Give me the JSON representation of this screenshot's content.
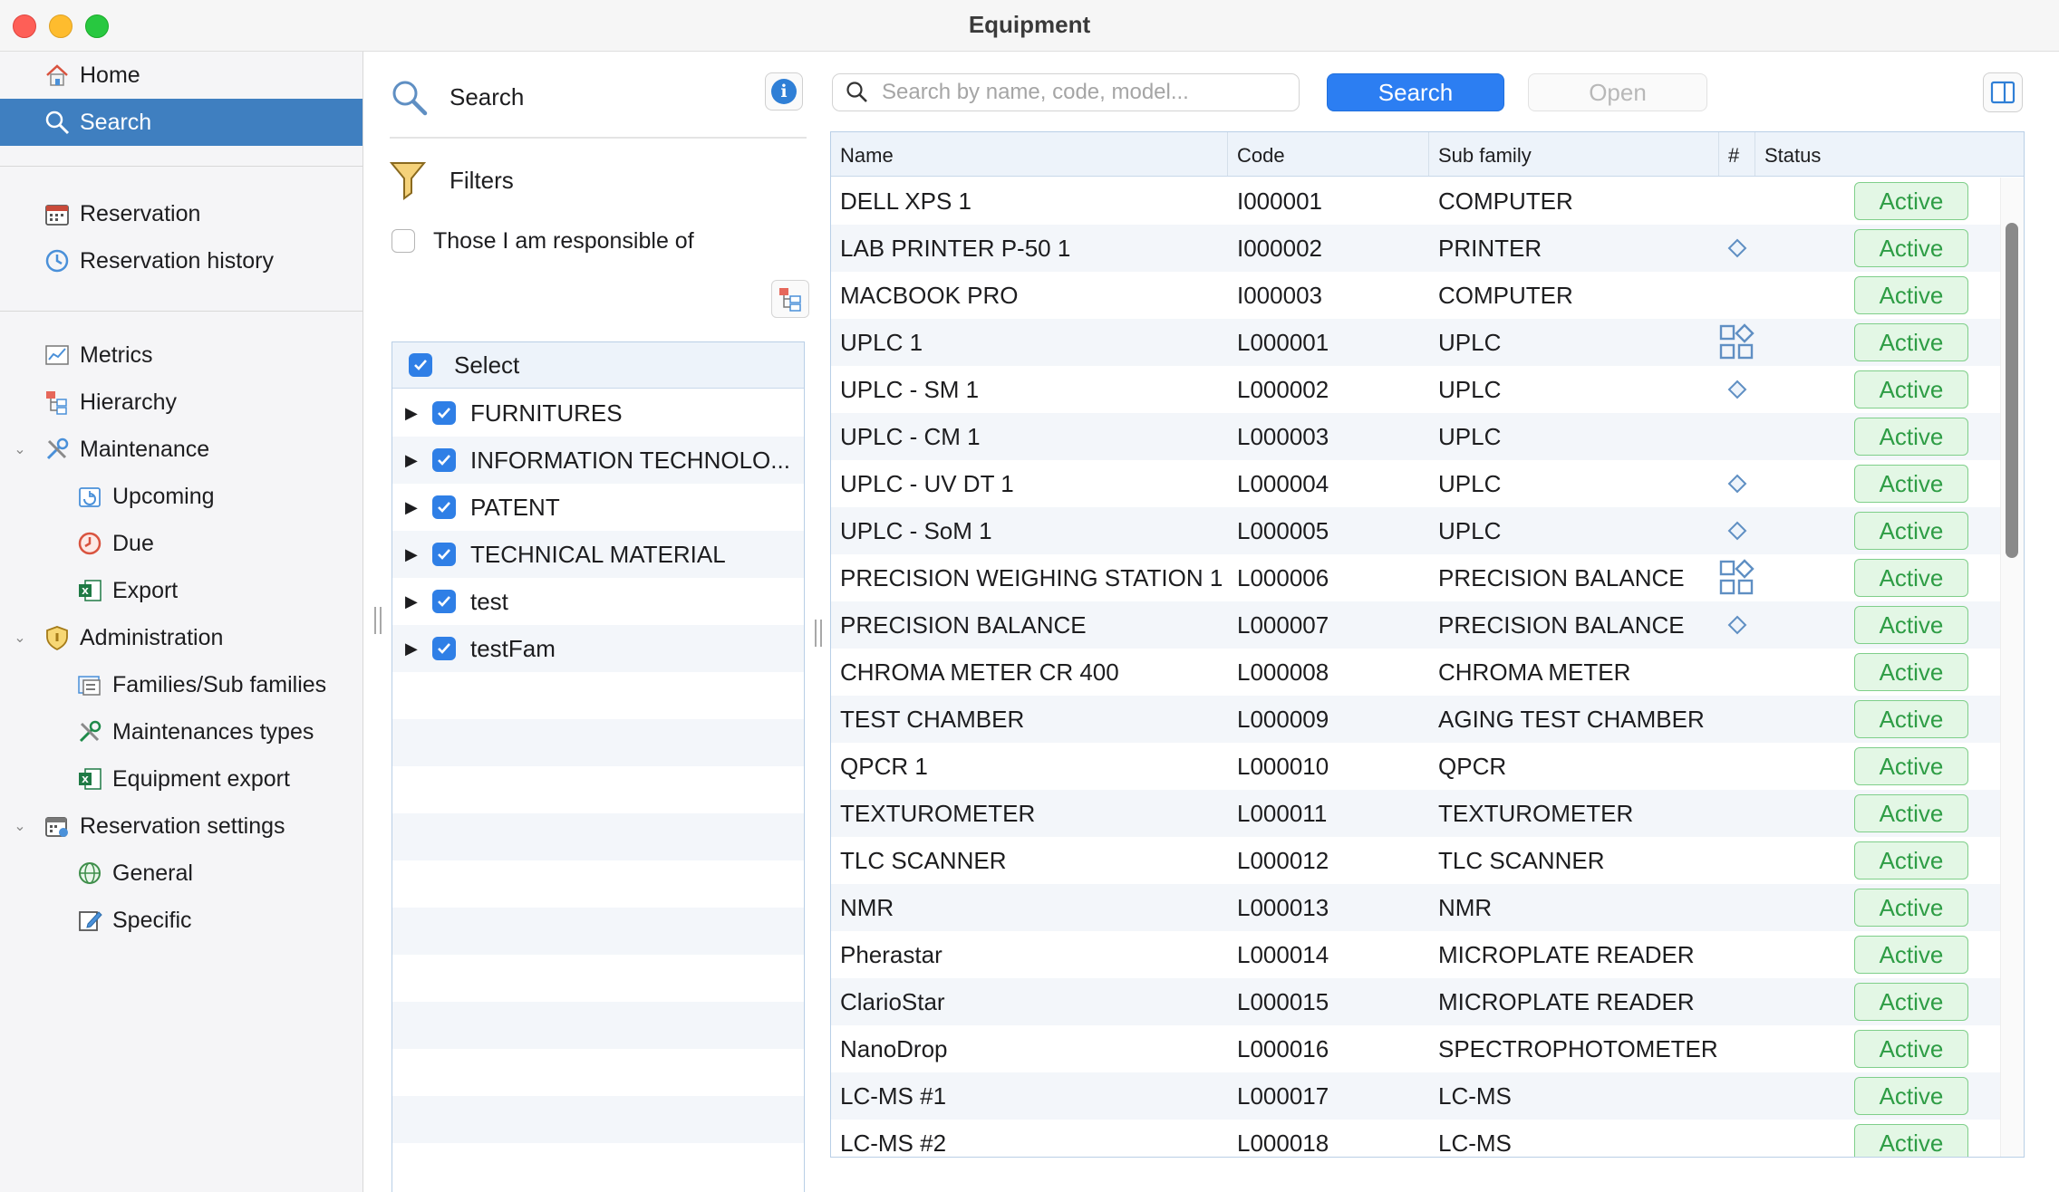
{
  "window": {
    "title": "Equipment"
  },
  "sidebar": {
    "items": [
      {
        "label": "Home",
        "icon": "home-icon"
      },
      {
        "label": "Search",
        "icon": "search-icon",
        "selected": true
      },
      {
        "label": "Reservation",
        "icon": "calendar-icon"
      },
      {
        "label": "Reservation history",
        "icon": "history-icon"
      },
      {
        "label": "Metrics",
        "icon": "chart-icon"
      },
      {
        "label": "Hierarchy",
        "icon": "hierarchy-icon"
      },
      {
        "label": "Maintenance",
        "icon": "tools-icon"
      },
      {
        "label": "Upcoming",
        "icon": "upcoming-icon"
      },
      {
        "label": "Due",
        "icon": "due-clock-icon"
      },
      {
        "label": "Export",
        "icon": "excel-icon"
      },
      {
        "label": "Administration",
        "icon": "shield-icon"
      },
      {
        "label": "Families/Sub families",
        "icon": "families-icon"
      },
      {
        "label": "Maintenances types",
        "icon": "tools-icon"
      },
      {
        "label": "Equipment export",
        "icon": "excel-icon"
      },
      {
        "label": "Reservation settings",
        "icon": "calendar-settings-icon"
      },
      {
        "label": "General",
        "icon": "globe-icon"
      },
      {
        "label": "Specific",
        "icon": "edit-icon"
      }
    ]
  },
  "filters": {
    "search_title": "Search",
    "filters_title": "Filters",
    "responsible_label": "Those I am responsible of",
    "responsible_checked": false,
    "tree_header": "Select",
    "tree_items": [
      {
        "label": "FURNITURES",
        "checked": true
      },
      {
        "label": "INFORMATION TECHNOLO...",
        "checked": true
      },
      {
        "label": "PATENT",
        "checked": true
      },
      {
        "label": "TECHNICAL MATERIAL",
        "checked": true
      },
      {
        "label": "test",
        "checked": true
      },
      {
        "label": "testFam",
        "checked": true
      }
    ]
  },
  "toolbar": {
    "search_placeholder": "Search by name, code, model...",
    "search_value": "",
    "search_button": "Search",
    "open_button": "Open"
  },
  "table": {
    "columns": [
      "Name",
      "Code",
      "Sub family",
      "#",
      "Status"
    ],
    "rows": [
      {
        "name": "DELL XPS 1",
        "code": "I000001",
        "sub_family": "COMPUTER",
        "hash": "",
        "status": "Active"
      },
      {
        "name": "LAB PRINTER P-50 1",
        "code": "I000002",
        "sub_family": "PRINTER",
        "hash": "diamond-icon",
        "status": "Active"
      },
      {
        "name": "MACBOOK PRO",
        "code": "I000003",
        "sub_family": "COMPUTER",
        "hash": "",
        "status": "Active"
      },
      {
        "name": "UPLC 1",
        "code": "L000001",
        "sub_family": "UPLC",
        "hash": "components-icon",
        "status": "Active"
      },
      {
        "name": "UPLC - SM 1",
        "code": "L000002",
        "sub_family": "UPLC",
        "hash": "diamond-icon",
        "status": "Active"
      },
      {
        "name": "UPLC - CM 1",
        "code": "L000003",
        "sub_family": "UPLC",
        "hash": "",
        "status": "Active"
      },
      {
        "name": "UPLC - UV DT 1",
        "code": "L000004",
        "sub_family": "UPLC",
        "hash": "diamond-icon",
        "status": "Active"
      },
      {
        "name": "UPLC - SoM 1",
        "code": "L000005",
        "sub_family": "UPLC",
        "hash": "diamond-icon",
        "status": "Active"
      },
      {
        "name": "PRECISION WEIGHING STATION 1",
        "code": "L000006",
        "sub_family": "PRECISION BALANCE",
        "hash": "components-icon",
        "status": "Active"
      },
      {
        "name": "PRECISION BALANCE",
        "code": "L000007",
        "sub_family": "PRECISION BALANCE",
        "hash": "diamond-icon",
        "status": "Active"
      },
      {
        "name": "CHROMA METER CR 400",
        "code": "L000008",
        "sub_family": "CHROMA METER",
        "hash": "",
        "status": "Active"
      },
      {
        "name": "TEST CHAMBER",
        "code": "L000009",
        "sub_family": "AGING TEST CHAMBER",
        "hash": "",
        "status": "Active"
      },
      {
        "name": "QPCR 1",
        "code": "L000010",
        "sub_family": "QPCR",
        "hash": "",
        "status": "Active"
      },
      {
        "name": "TEXTUROMETER",
        "code": "L000011",
        "sub_family": "TEXTUROMETER",
        "hash": "",
        "status": "Active"
      },
      {
        "name": "TLC SCANNER",
        "code": "L000012",
        "sub_family": "TLC SCANNER",
        "hash": "",
        "status": "Active"
      },
      {
        "name": "NMR",
        "code": "L000013",
        "sub_family": "NMR",
        "hash": "",
        "status": "Active"
      },
      {
        "name": "Pherastar",
        "code": "L000014",
        "sub_family": "MICROPLATE READER",
        "hash": "",
        "status": "Active"
      },
      {
        "name": "ClarioStar",
        "code": "L000015",
        "sub_family": "MICROPLATE READER",
        "hash": "",
        "status": "Active"
      },
      {
        "name": "NanoDrop",
        "code": "L000016",
        "sub_family": "SPECTROPHOTOMETER",
        "hash": "",
        "status": "Active"
      },
      {
        "name": "LC-MS #1",
        "code": "L000017",
        "sub_family": "LC-MS",
        "hash": "",
        "status": "Active"
      },
      {
        "name": "LC-MS #2",
        "code": "L000018",
        "sub_family": "LC-MS",
        "hash": "",
        "status": "Active"
      }
    ]
  },
  "colors": {
    "accent": "#2c7ef2",
    "sidebar_selected": "#3f7fc0",
    "status_active_bg": "#e3f7e5",
    "status_active_fg": "#2e9d45"
  }
}
